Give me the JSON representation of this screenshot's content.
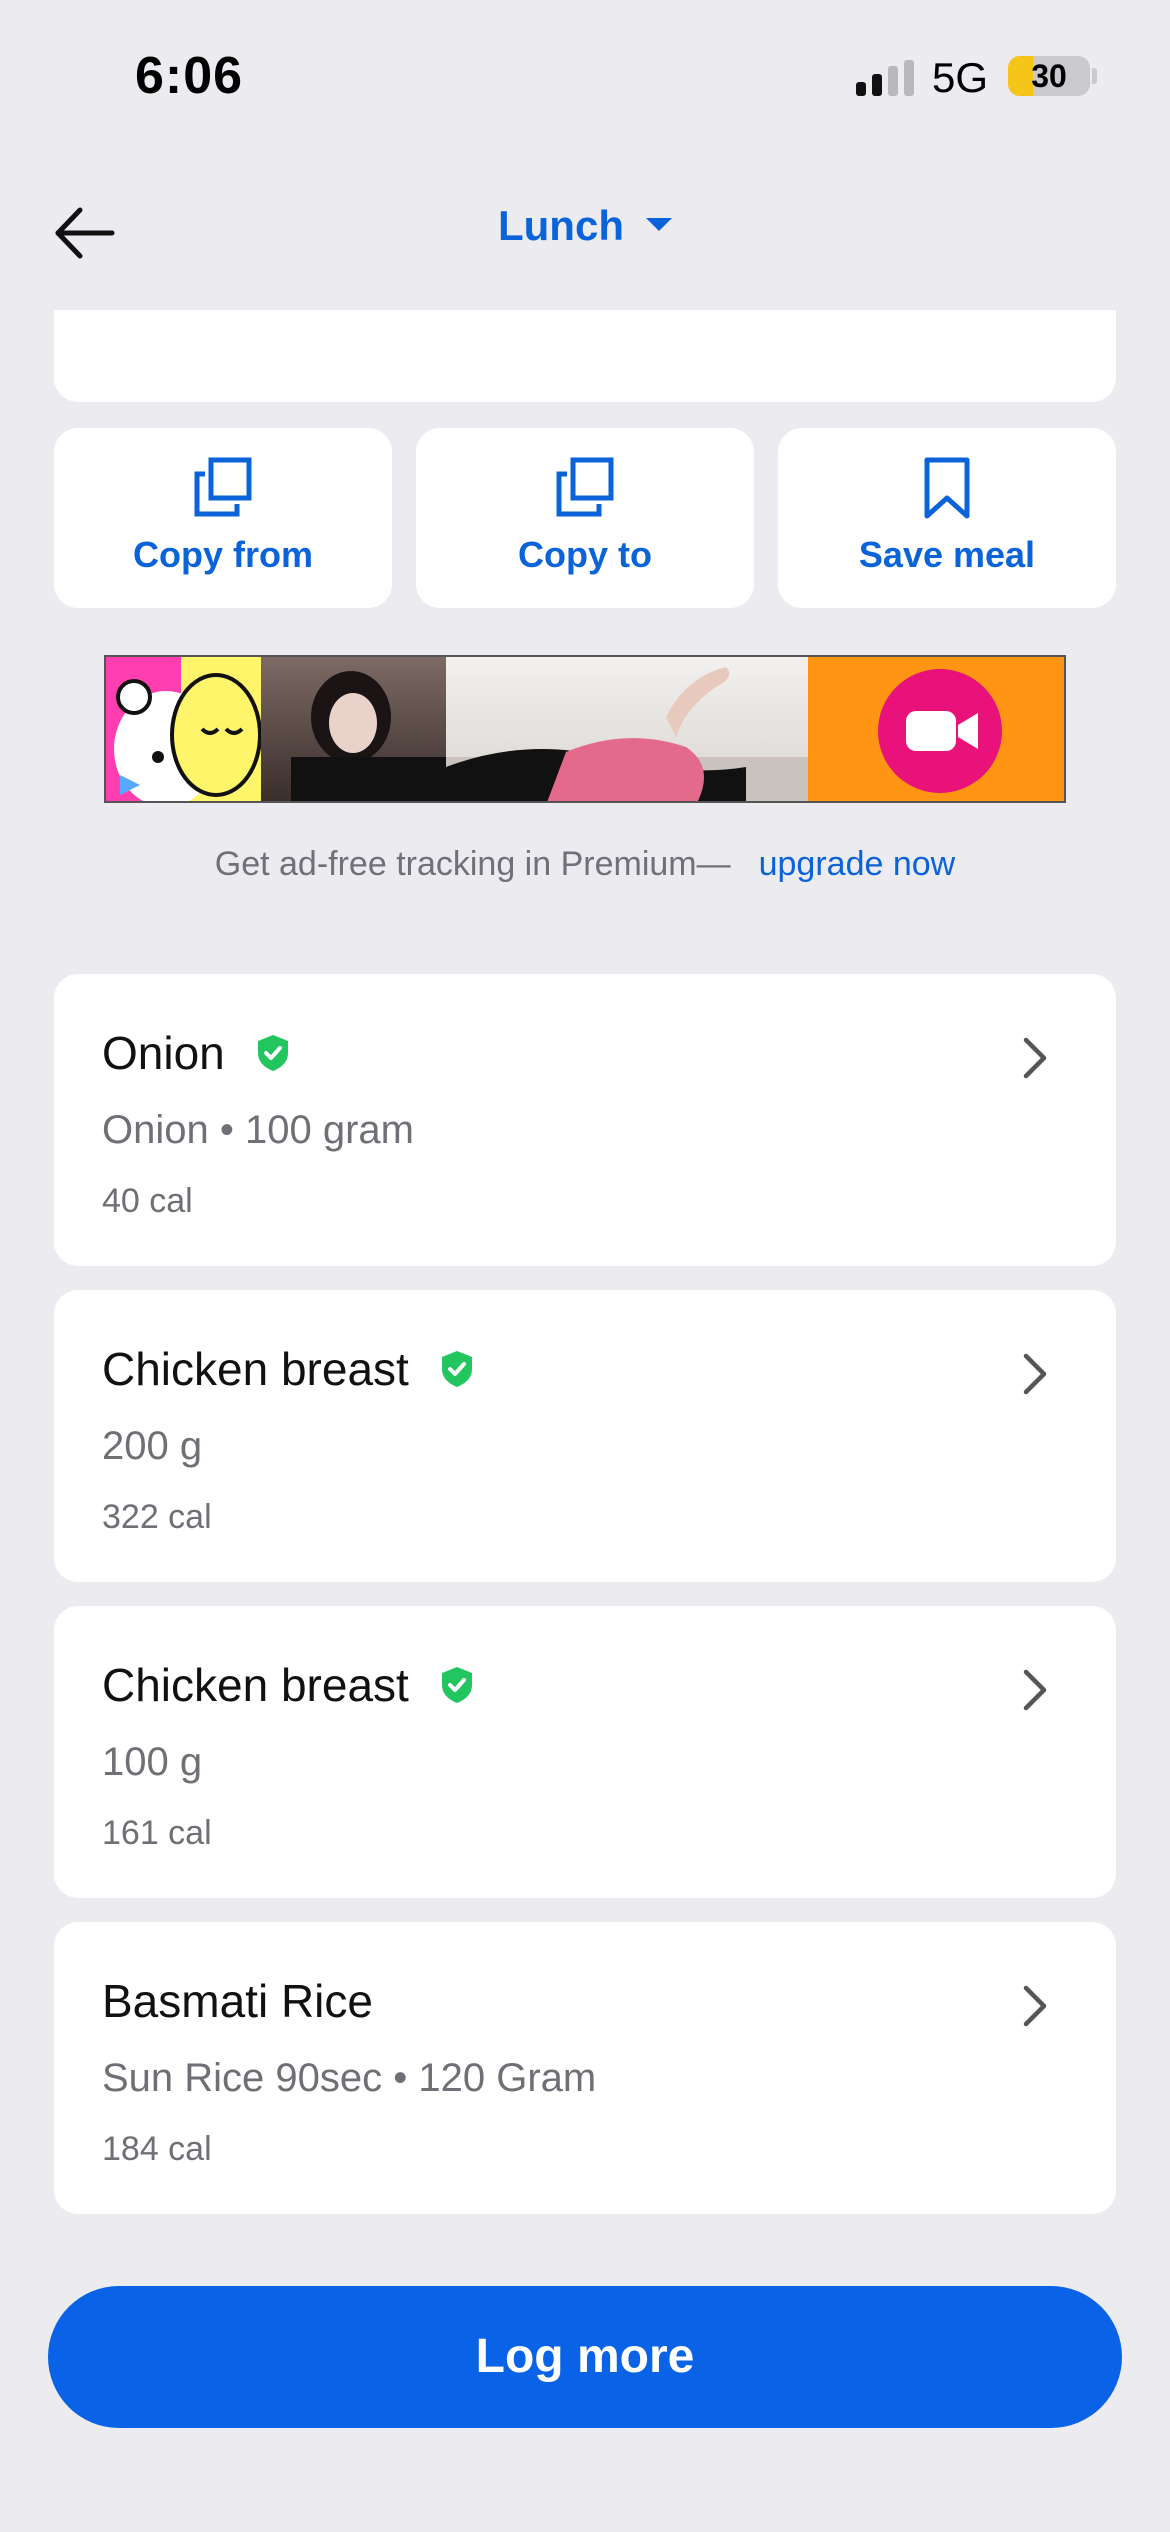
{
  "status_bar": {
    "time": "6:06",
    "network": "5G",
    "battery": "30",
    "battery_level": 0.3,
    "signal_bars": 2
  },
  "header": {
    "meal": "Lunch"
  },
  "actions": [
    {
      "label": "Copy from",
      "icon": "copy-icon"
    },
    {
      "label": "Copy to",
      "icon": "copy-icon"
    },
    {
      "label": "Save meal",
      "icon": "bookmark-icon"
    }
  ],
  "ad": {
    "icon": "video-call-icon"
  },
  "premium": {
    "text": "Get ad-free tracking in Premium—",
    "link": "upgrade now"
  },
  "foods": [
    {
      "name": "Onion",
      "verified": true,
      "desc": "Onion • 100 gram",
      "cal": "40 cal"
    },
    {
      "name": "Chicken breast",
      "verified": true,
      "desc": "200 g",
      "cal": "322 cal"
    },
    {
      "name": "Chicken breast",
      "verified": true,
      "desc": "100 g",
      "cal": "161 cal"
    },
    {
      "name": "Basmati Rice",
      "verified": false,
      "desc": "Sun Rice 90sec • 120 Gram",
      "cal": "184 cal"
    }
  ],
  "log_more": "Log more",
  "colors": {
    "accent": "#0a63d9",
    "verified": "#22c55e",
    "background": "#ebebf0"
  }
}
